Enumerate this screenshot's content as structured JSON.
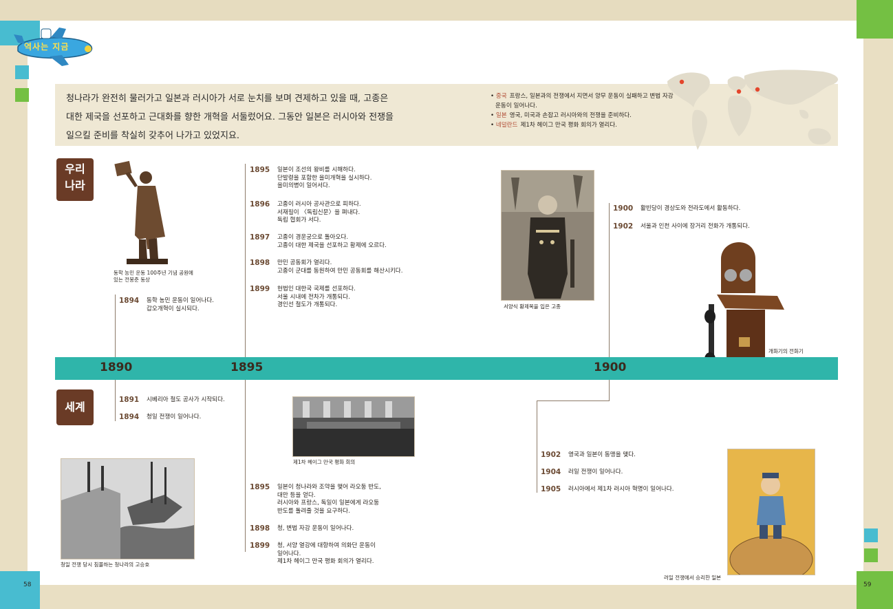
{
  "badge": "역사는 지금",
  "intro": {
    "lines": [
      "청나라가 완전히 물러가고 일본과 러시아가 서로 눈치를 보며 견제하고 있을 때, 고종은",
      "대한 제국을 선포하고 근대화를 향한 개혁을 서둘렀어요. 그동안 일본은 러시아와 전쟁을",
      "일으킬 준비를 착실히 갖추어 나가고 있었지요."
    ]
  },
  "world_notes": [
    {
      "b": "중국",
      "t": "프랑스, 일본과의 전쟁에서 지면서 양무 운동이 실패하고 변법 자강 운동이 일어나다."
    },
    {
      "b": "일본",
      "t": "영국, 미국과 손잡고 러시아와의 전쟁을 준비하다."
    },
    {
      "b": "네덜란드",
      "t": "제1차 헤이그 만국 평화 회의가 열리다."
    }
  ],
  "sections": {
    "korea": [
      "우리",
      "나라"
    ],
    "world": "세계"
  },
  "timeline": {
    "years": [
      "1890",
      "1895",
      "1900"
    ]
  },
  "korea_events": {
    "g1894": [
      {
        "year": "1894",
        "lines": [
          "동학 농민 운동이 일어나다.",
          "갑오개혁이 실시되다."
        ]
      }
    ],
    "g1895": [
      {
        "year": "1895",
        "lines": [
          "일본이 조선의 왕비를 시해하다.",
          "단발령을 포함한 을미개혁을 실시하다.",
          "을미의병이 일어서다."
        ]
      },
      {
        "year": "1896",
        "lines": [
          "고종이 러시아 공사관으로 피하다.",
          "서재필이 〈독립신문〉을 펴내다.",
          "독립 협회가 서다."
        ]
      },
      {
        "year": "1897",
        "lines": [
          "고종이 경운궁으로 돌아오다.",
          "고종이 대한 제국을 선포하고 황제에 오르다."
        ]
      },
      {
        "year": "1898",
        "lines": [
          "만민 공동회가 열리다.",
          "고종이 군대를 동원하여 만민 공동회를 해산시키다."
        ]
      },
      {
        "year": "1899",
        "lines": [
          "헌법인 대한국 국제를 선포하다.",
          "서울 시내에 전차가 개통되다.",
          "경인선 철도가 개통되다."
        ]
      }
    ],
    "g1900": [
      {
        "year": "1900",
        "lines": [
          "활빈당이 경상도와 전라도에서 활동하다."
        ]
      },
      {
        "year": "1902",
        "lines": [
          "서울과 인천 사이에 장거리 전화가 개통되다."
        ]
      }
    ]
  },
  "world_events": {
    "g1891": [
      {
        "year": "1891",
        "lines": [
          "시베리아 철도 공사가 시작되다."
        ]
      },
      {
        "year": "1894",
        "lines": [
          "청일 전쟁이 일어나다."
        ]
      }
    ],
    "g1895": [
      {
        "year": "1895",
        "lines": [
          "일본이 청나라와 조약을 맺어 라오둥 반도,",
          "대만 등을 얻다.",
          "러시아와 프랑스, 독일이 일본에게 라오둥",
          "반도를 돌려줄 것을 요구하다."
        ]
      },
      {
        "year": "1898",
        "lines": [
          "청, 변법 자강 운동이 일어나다."
        ]
      },
      {
        "year": "1899",
        "lines": [
          "청, 서양 열강에 대항하여 의화단 운동이",
          "일어나다.",
          "제1차 헤이그 만국 평화 회의가 열리다."
        ]
      }
    ],
    "g1902": [
      {
        "year": "1902",
        "lines": [
          "영국과 일본이 동맹을 맺다."
        ]
      },
      {
        "year": "1904",
        "lines": [
          "러일 전쟁이 일어나다."
        ]
      },
      {
        "year": "1905",
        "lines": [
          "러시아에서 제1차 러시아 혁명이 일어나다."
        ]
      }
    ]
  },
  "captions": {
    "statue": [
      "동학 농민 운동 100주년 기념 공원에",
      "있는 전봉준 동상"
    ],
    "gojong": "서양식 황제복을 입은 고종",
    "telephone": "개화기의 전화기",
    "hague": "제1차 헤이그 만국 평화 회의",
    "warship": "청일 전쟁 당시 침몰하는 청나라의 고승호",
    "cartoon": "러일 전쟁에서 승리한 일본"
  },
  "page_numbers": {
    "left": "58",
    "right": "59"
  },
  "colors": {
    "teal": "#2fb5aa",
    "brown_badge": "#6a3b26",
    "year_brown": "#6b4a33",
    "accent_green": "#74c043",
    "accent_blue": "#48bcd0"
  }
}
